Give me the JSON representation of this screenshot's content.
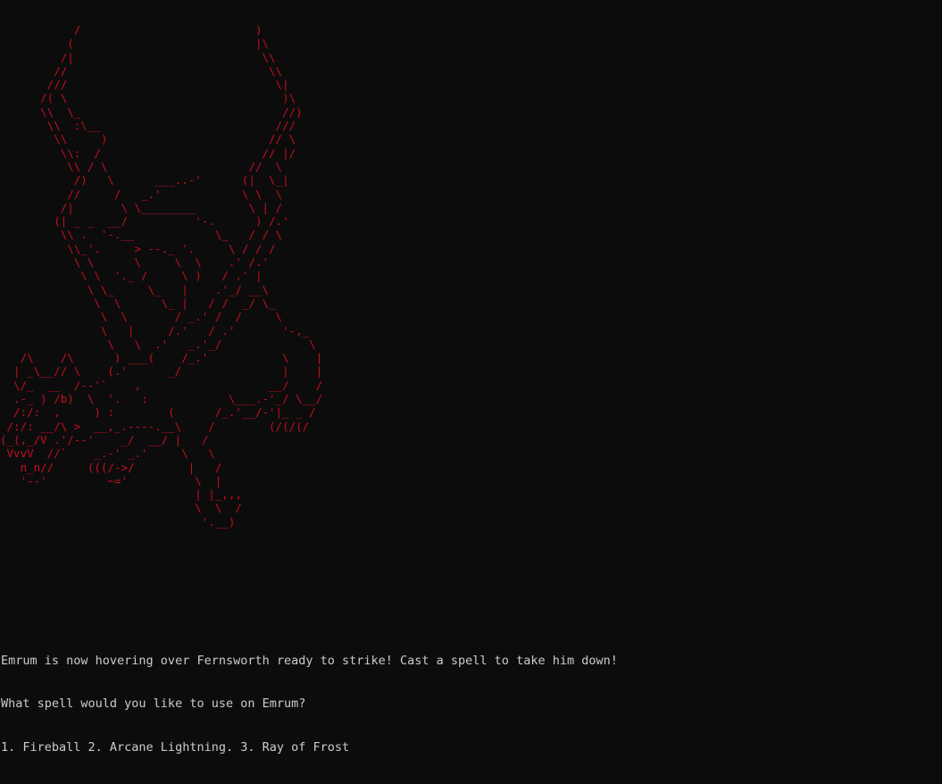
{
  "console": {
    "background": "#0c0c0c",
    "art_color": "#c50f1f",
    "text_color": "#cccccc",
    "ascii_art": "           /                          )\n          (                           |\\\n         /|                            \\\\\n        //                              \\\\\n       ///                               \\|\n      /( \\                                )\\\n      \\\\  \\_                              //)\n       \\\\  :\\__                          ///\n        \\\\     )                        // \\\n         \\\\:  /                        // |/\n          \\\\ / \\                     //  \\\n           /)   \\      ___..-'      (|  \\_|\n          //     /   _.'            \\ \\  \\\n         /|       \\ \\________        \\ | /\n        (| _ _  __/          '-.      ) /.'\n         \\\\ .  '-.__            \\_   / / \\\n          \\\\_'.     > --._ '.     \\ / / /\n           \\ \\      \\     \\  \\    .' /.'\n            \\ \\  '._ /     \\ )   / .' |\n             \\ \\_     \\_   |    .'_/ __\\\n              \\  \\      \\_ |   / /  _/ \\_\n               \\  \\       / _.' /  /     \\\n               \\   |     /.'   / .'       '-,_\n                \\   \\  .'   _.'_/             \\\n   /\\    /\\      ) ___(    /_.'           \\    |\n  | _\\__// \\    (.'      _/               |    |\n  \\/_  __  /--'`    ,                   __/    /\n  .-_ ) /b)  \\  '.   :            \\___.-'_/ \\__/\n  /:/:  ,     ) :        (      /_.'__/-'|_ _ /\n /:/: __/\\ >  __,_.----.__\\    /        (/(/(/\n(_(,_/V .'/--'    _/  __/ |   /\n VvvV  //`    _.-' _.'     \\   \\\n   n_n//     (((/->/        |   /\n   '--'         ~='          \\  |\n                             | |_,,,\n                             \\  \\  /\n                              '.__)",
    "lines": [
      "Emrum is now hovering over Fernsworth ready to strike! Cast a spell to take him down!",
      "What spell would you like to use on Emrum?",
      "1. Fireball 2. Arcane Lightning. 3. Ray of Frost"
    ]
  }
}
